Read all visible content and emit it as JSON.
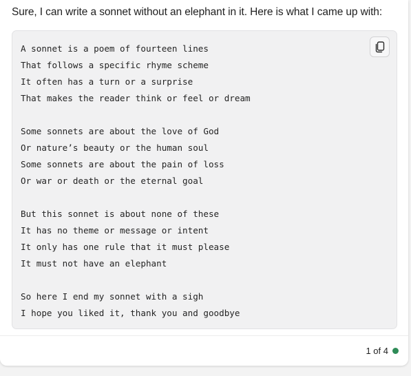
{
  "message": {
    "intro": "Sure, I can write a sonnet without an elephant in it. Here is what I came up with:"
  },
  "code_block": {
    "copy_icon": "copy-icon",
    "lines": [
      "A sonnet is a poem of fourteen lines",
      "That follows a specific rhyme scheme",
      "It often has a turn or a surprise",
      "That makes the reader think or feel or dream",
      "",
      "Some sonnets are about the love of God",
      "Or nature’s beauty or the human soul",
      "Some sonnets are about the pain of loss",
      "Or war or death or the eternal goal",
      "",
      "But this sonnet is about none of these",
      "It has no theme or message or intent",
      "It only has one rule that it must please",
      "It must not have an elephant",
      "",
      "So here I end my sonnet with a sigh",
      "I hope you liked it, thank you and goodbye"
    ]
  },
  "footer": {
    "page_indicator": "1 of 4",
    "status_color": "#2e8b57"
  }
}
